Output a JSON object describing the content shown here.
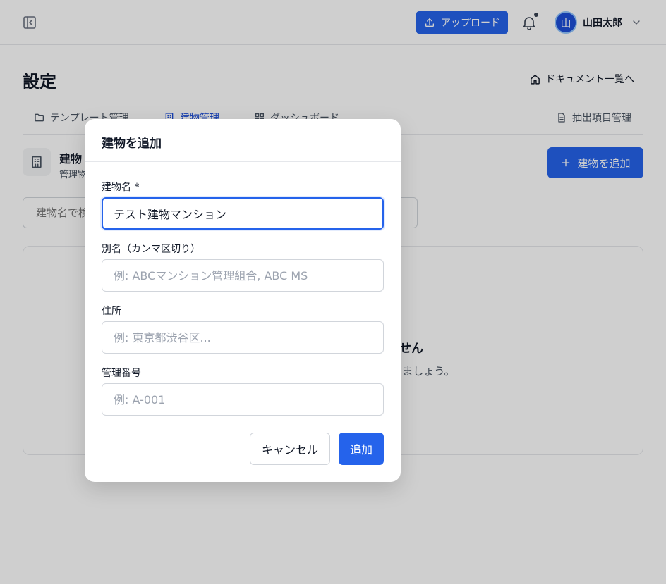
{
  "header": {
    "upload_label": "アップロード",
    "avatar_initial": "山",
    "user_name": "山田太郎"
  },
  "page": {
    "title": "設定",
    "doc_list_link": "ドキュメント一覧へ"
  },
  "tabs": [
    {
      "label": "テンプレート管理",
      "icon": "folder-icon"
    },
    {
      "label": "建物管理",
      "icon": "building-icon",
      "active": true
    },
    {
      "label": "ダッシュボード",
      "icon": "dashboard-grid-icon"
    },
    {
      "label": "抽出項目管理",
      "icon": "document-icon"
    }
  ],
  "section": {
    "title": "建物",
    "subtitle": "管理物",
    "add_button": "建物を追加",
    "search_placeholder": "建物名で検索..."
  },
  "empty_state": {
    "title": "登録されている建物がありません",
    "description": "建物を追加して、ドキュメントを整理しましょう。"
  },
  "modal": {
    "title": "建物を追加",
    "fields": [
      {
        "label": "建物名 *",
        "value": "テスト建物マンション",
        "placeholder": ""
      },
      {
        "label": "別名（カンマ区切り）",
        "value": "",
        "placeholder": "例: ABCマンション管理組合, ABC MS"
      },
      {
        "label": "住所",
        "value": "",
        "placeholder": "例: 東京都渋谷区..."
      },
      {
        "label": "管理番号",
        "value": "",
        "placeholder": "例: A-001"
      }
    ],
    "cancel_label": "キャンセル",
    "submit_label": "追加"
  },
  "colors": {
    "primary": "#2563eb",
    "overlay": "rgba(0,0,0,0.19)"
  }
}
